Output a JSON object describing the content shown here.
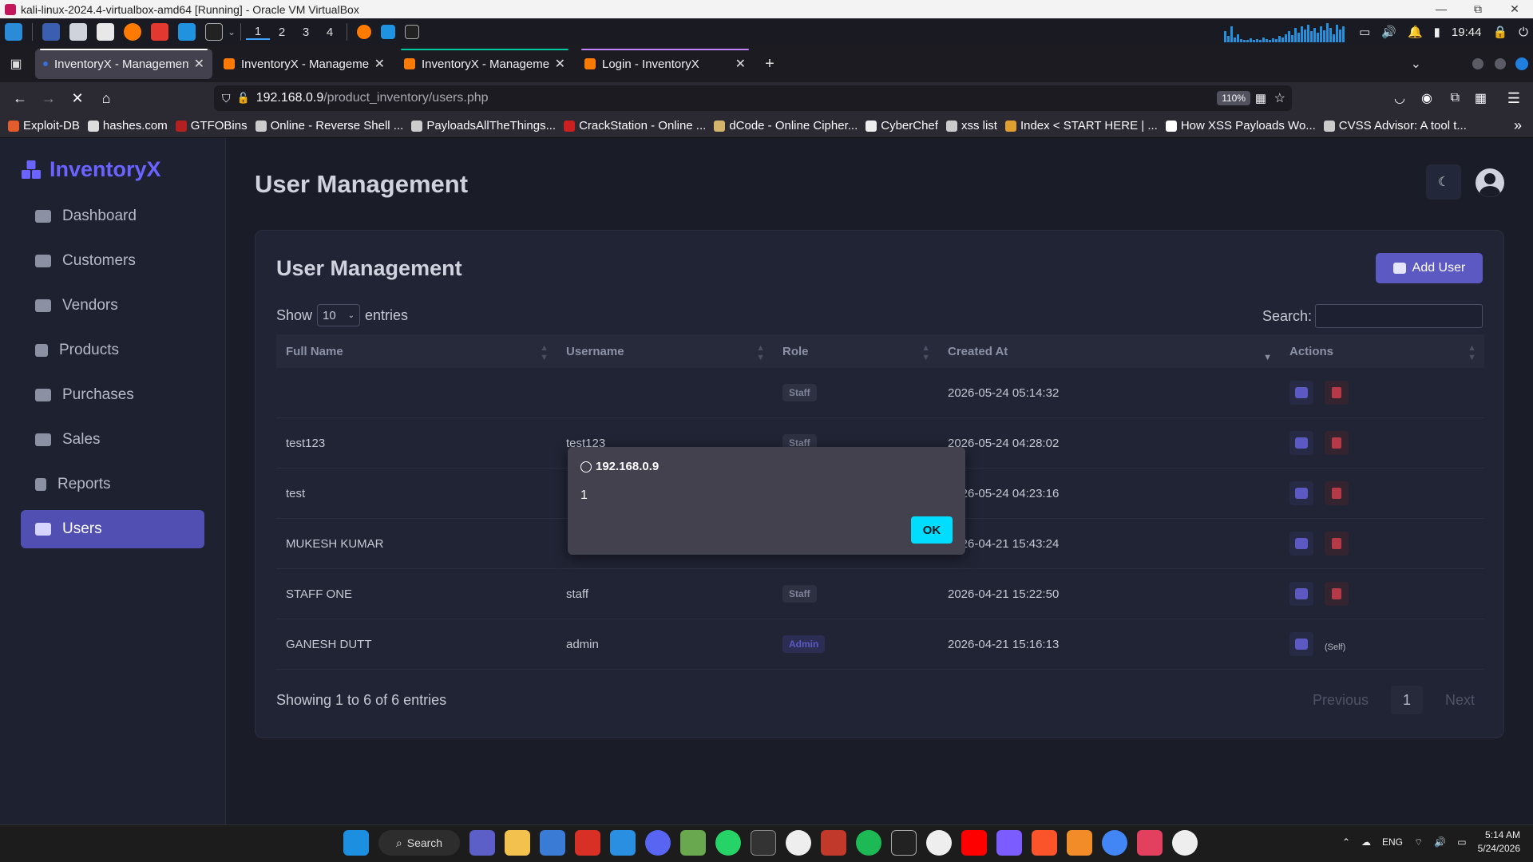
{
  "vbox": {
    "title": "kali-linux-2024.4-virtualbox-amd64 [Running] - Oracle VM VirtualBox",
    "controls": [
      "—",
      "⧉",
      "✕"
    ]
  },
  "kali_panel": {
    "workspaces": [
      "1",
      "2",
      "3",
      "4"
    ],
    "time": "19:44"
  },
  "browser": {
    "tabs": [
      {
        "title": "InventoryX - Management",
        "accent": "#ffffff"
      },
      {
        "title": "InventoryX - Management",
        "accent": "#1c1b22"
      },
      {
        "title": "InventoryX - Management",
        "accent": "#00c8a0"
      },
      {
        "title": "Login - InventoryX",
        "accent": "#c084fc"
      }
    ],
    "new_tab": "+",
    "url_host": "192.168.0.9",
    "url_path": "/product_inventory/users.php",
    "zoom": "110%",
    "bookmarks": [
      {
        "label": "Exploit-DB",
        "color": "#e25c2d"
      },
      {
        "label": "hashes.com",
        "color": "#dddddd"
      },
      {
        "label": "GTFOBins",
        "color": "#b32020"
      },
      {
        "label": "Online - Reverse Shell ...",
        "color": "#cccccc"
      },
      {
        "label": "PayloadsAllTheThings...",
        "color": "#cccccc"
      },
      {
        "label": "CrackStation - Online ...",
        "color": "#cc2020"
      },
      {
        "label": "dCode - Online Cipher...",
        "color": "#d4b36a"
      },
      {
        "label": "CyberChef",
        "color": "#eeeeee"
      },
      {
        "label": "xss list",
        "color": "#cccccc"
      },
      {
        "label": "Index < START HERE | ...",
        "color": "#e0a030"
      },
      {
        "label": "How XSS Payloads Wo...",
        "color": "#ffffff"
      },
      {
        "label": "CVSS Advisor: A tool t...",
        "color": "#cccccc"
      }
    ]
  },
  "app": {
    "brand": "InventoryX",
    "nav": [
      {
        "label": "Dashboard",
        "active": false
      },
      {
        "label": "Customers",
        "active": false
      },
      {
        "label": "Vendors",
        "active": false
      },
      {
        "label": "Products",
        "active": false
      },
      {
        "label": "Purchases",
        "active": false
      },
      {
        "label": "Sales",
        "active": false
      },
      {
        "label": "Reports",
        "active": false
      },
      {
        "label": "Users",
        "active": true
      }
    ],
    "page_title": "User Management",
    "theme_icon": "☾",
    "card": {
      "title": "User Management",
      "add_button": "Add User",
      "show_label": "Show",
      "entries_value": "10",
      "entries_label": "entries",
      "search_label": "Search:",
      "columns": [
        "Full Name",
        "Username",
        "Role",
        "Created At",
        "Actions"
      ],
      "rows": [
        {
          "full_name": "",
          "username": "",
          "role": "Staff",
          "created_at": "2026-05-24 05:14:32",
          "self": false
        },
        {
          "full_name": "test123",
          "username": "test123",
          "role": "Staff",
          "created_at": "2026-05-24 04:28:02",
          "self": false
        },
        {
          "full_name": "test",
          "username": "",
          "role": "",
          "created_at": "2026-05-24 04:23:16",
          "self": false
        },
        {
          "full_name": "MUKESH KUMAR",
          "username": "",
          "role": "",
          "created_at": "2026-04-21 15:43:24",
          "self": false
        },
        {
          "full_name": "STAFF ONE",
          "username": "staff",
          "role": "Staff",
          "created_at": "2026-04-21 15:22:50",
          "self": false
        },
        {
          "full_name": "GANESH DUTT",
          "username": "admin",
          "role": "Admin",
          "created_at": "2026-04-21 15:16:13",
          "self": true
        }
      ],
      "self_label": "(Self)",
      "showing": "Showing 1 to 6 of 6 entries",
      "prev": "Previous",
      "page": "1",
      "next": "Next"
    }
  },
  "alert": {
    "origin": "192.168.0.9",
    "message": "1",
    "ok": "OK"
  },
  "taskbar": {
    "search": "Search",
    "lang": "ENG",
    "time": "5:14 AM",
    "date": "5/24/2026"
  }
}
